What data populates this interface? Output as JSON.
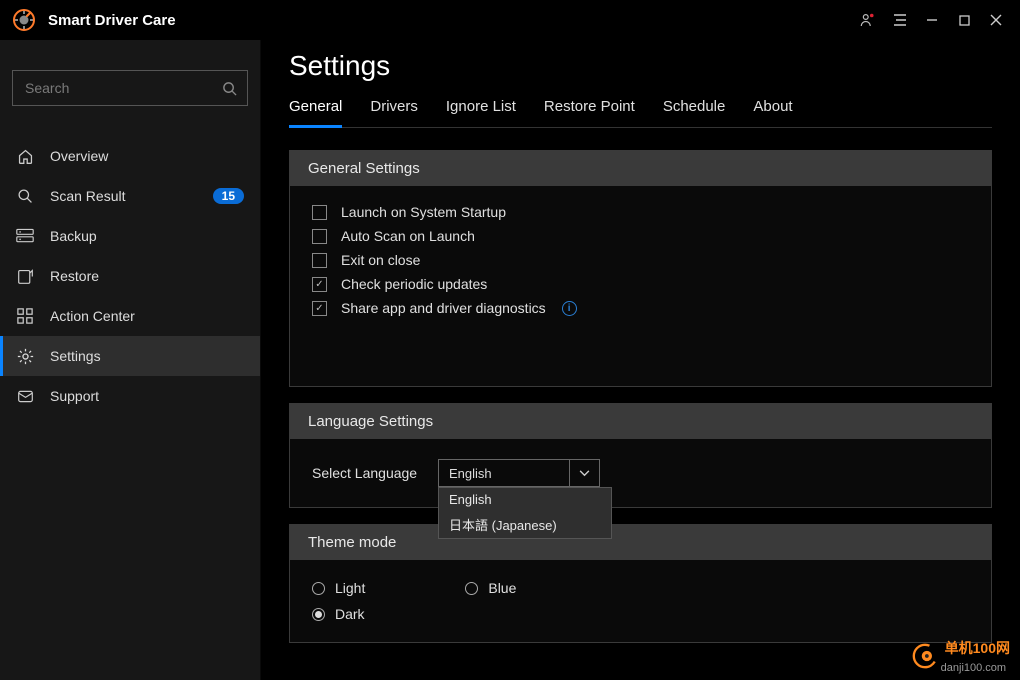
{
  "app": {
    "name": "Smart Driver Care"
  },
  "search": {
    "placeholder": "Search"
  },
  "sidebar": {
    "items": [
      {
        "label": "Overview"
      },
      {
        "label": "Scan Result",
        "badge": "15"
      },
      {
        "label": "Backup"
      },
      {
        "label": "Restore"
      },
      {
        "label": "Action Center"
      },
      {
        "label": "Settings"
      },
      {
        "label": "Support"
      }
    ]
  },
  "page": {
    "title": "Settings"
  },
  "tabs": [
    {
      "label": "General"
    },
    {
      "label": "Drivers"
    },
    {
      "label": "Ignore List"
    },
    {
      "label": "Restore Point"
    },
    {
      "label": "Schedule"
    },
    {
      "label": "About"
    }
  ],
  "general": {
    "heading": "General Settings",
    "options": [
      {
        "label": "Launch on System Startup",
        "checked": false
      },
      {
        "label": "Auto Scan on Launch",
        "checked": false
      },
      {
        "label": "Exit on close",
        "checked": false
      },
      {
        "label": "Check periodic updates",
        "checked": true
      },
      {
        "label": "Share app and driver diagnostics",
        "checked": true,
        "info": true
      }
    ]
  },
  "language": {
    "heading": "Language Settings",
    "label": "Select Language",
    "value": "English",
    "options": [
      "English",
      "日本語 (Japanese)"
    ]
  },
  "theme": {
    "heading": "Theme mode",
    "options": [
      "Light",
      "Dark",
      "Blue"
    ],
    "selected": "Dark"
  },
  "watermark": {
    "text": "单机100网",
    "sub": "danji100.com"
  }
}
